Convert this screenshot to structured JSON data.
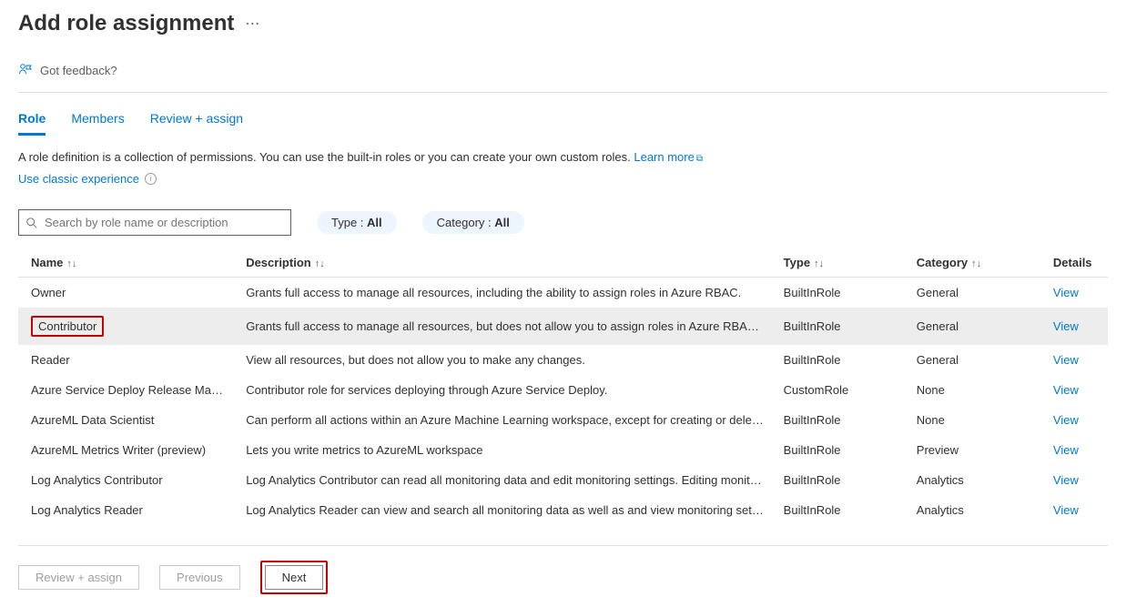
{
  "page_title": "Add role assignment",
  "feedback": "Got feedback?",
  "tabs": {
    "role": "Role",
    "members": "Members",
    "review": "Review + assign"
  },
  "desc": {
    "line": "A role definition is a collection of permissions. You can use the built-in roles or you can create your own custom roles. ",
    "learn_more": "Learn more",
    "classic": "Use classic experience"
  },
  "search": {
    "placeholder": "Search by role name or description"
  },
  "filters": {
    "type_label": "Type : ",
    "type_value": "All",
    "category_label": "Category : ",
    "category_value": "All"
  },
  "columns": {
    "name": "Name",
    "description": "Description",
    "type": "Type",
    "category": "Category",
    "details": "Details"
  },
  "view": "View",
  "rows": [
    {
      "name": "Owner",
      "desc": "Grants full access to manage all resources, including the ability to assign roles in Azure RBAC.",
      "type": "BuiltInRole",
      "cat": "General"
    },
    {
      "name": "Contributor",
      "desc": "Grants full access to manage all resources, but does not allow you to assign roles in Azure RBAC, ma…",
      "type": "BuiltInRole",
      "cat": "General"
    },
    {
      "name": "Reader",
      "desc": "View all resources, but does not allow you to make any changes.",
      "type": "BuiltInRole",
      "cat": "General"
    },
    {
      "name": "Azure Service Deploy Release Manage…",
      "desc": "Contributor role for services deploying through Azure Service Deploy.",
      "type": "CustomRole",
      "cat": "None"
    },
    {
      "name": "AzureML Data Scientist",
      "desc": "Can perform all actions within an Azure Machine Learning workspace, except for creating or deleting…",
      "type": "BuiltInRole",
      "cat": "None"
    },
    {
      "name": "AzureML Metrics Writer (preview)",
      "desc": "Lets you write metrics to AzureML workspace",
      "type": "BuiltInRole",
      "cat": "Preview"
    },
    {
      "name": "Log Analytics Contributor",
      "desc": "Log Analytics Contributor can read all monitoring data and edit monitoring settings. Editing monitor…",
      "type": "BuiltInRole",
      "cat": "Analytics"
    },
    {
      "name": "Log Analytics Reader",
      "desc": "Log Analytics Reader can view and search all monitoring data as well as and view monitoring setting…",
      "type": "BuiltInRole",
      "cat": "Analytics"
    }
  ],
  "footer": {
    "review": "Review + assign",
    "previous": "Previous",
    "next": "Next"
  }
}
